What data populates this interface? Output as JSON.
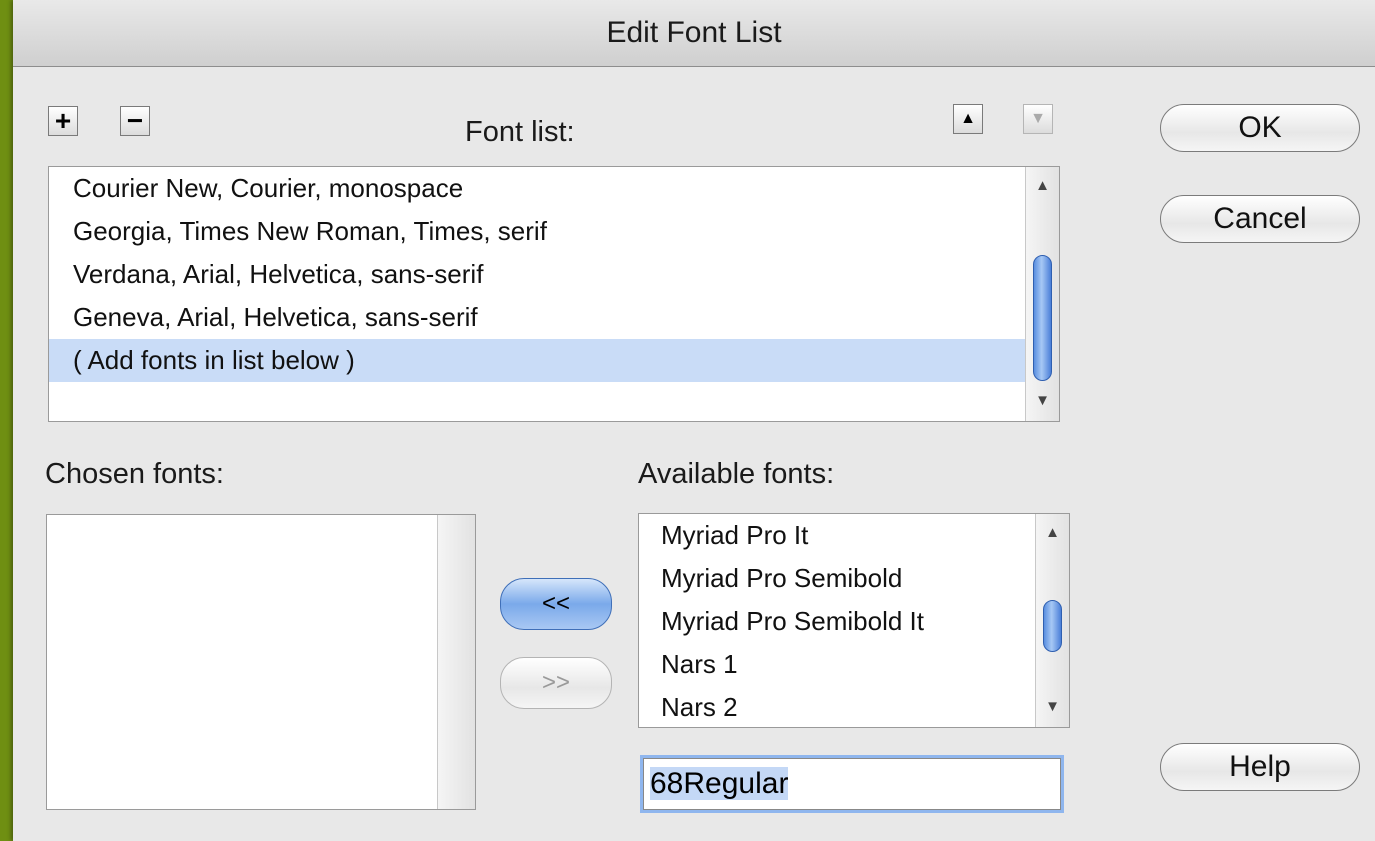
{
  "window": {
    "title": "Edit Font List"
  },
  "toolbar": {
    "add_label": "+",
    "remove_label": "−",
    "move_up_label": "▲",
    "move_down_label": "▼"
  },
  "font_list": {
    "label": "Font list:",
    "items": [
      "Courier New, Courier, monospace",
      "Georgia, Times New Roman, Times, serif",
      "Verdana, Arial, Helvetica, sans-serif",
      "Geneva, Arial, Helvetica, sans-serif",
      "( Add fonts in list below )"
    ],
    "selected_index": 4
  },
  "chosen_fonts": {
    "label": "Chosen fonts:",
    "items": []
  },
  "available_fonts": {
    "label": "Available fonts:",
    "items": [
      "Myriad Pro It",
      "Myriad Pro Semibold",
      "Myriad Pro Semibold It",
      "Nars 1",
      "Nars 2"
    ],
    "field_value": "68Regular"
  },
  "buttons": {
    "ok": "OK",
    "cancel": "Cancel",
    "help": "Help",
    "add_to_chosen": "<<",
    "remove_from_chosen": ">>"
  },
  "colors": {
    "selection": "#c9dcf7",
    "default_button": "#7aa9ea",
    "desktop": "#6f8f12"
  },
  "scrollbar_icons": {
    "up": "▲",
    "down": "▼"
  }
}
